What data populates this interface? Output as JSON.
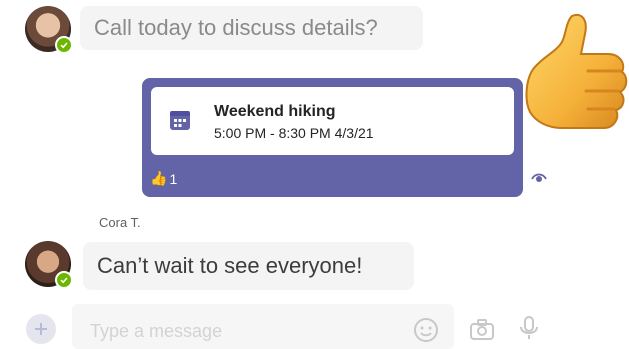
{
  "messages": [
    {
      "text": "Call today to discuss details?"
    },
    {
      "sender": "Cora T.",
      "text": "Can’t wait to see everyone!"
    }
  ],
  "event": {
    "title": "Weekend hiking",
    "time": "5:00 PM - 8:30 PM 4/3/21",
    "reaction_emoji": "👍",
    "reaction_count": "1"
  },
  "composer": {
    "placeholder": "Type a message"
  },
  "colors": {
    "accent": "#6264a7",
    "status": "#6bb700",
    "bubble": "#f4f4f4"
  },
  "icons": [
    "calendar-icon",
    "seen-icon",
    "emoji-icon",
    "camera-icon",
    "microphone-icon",
    "plus-icon",
    "thumbs-up-icon"
  ]
}
